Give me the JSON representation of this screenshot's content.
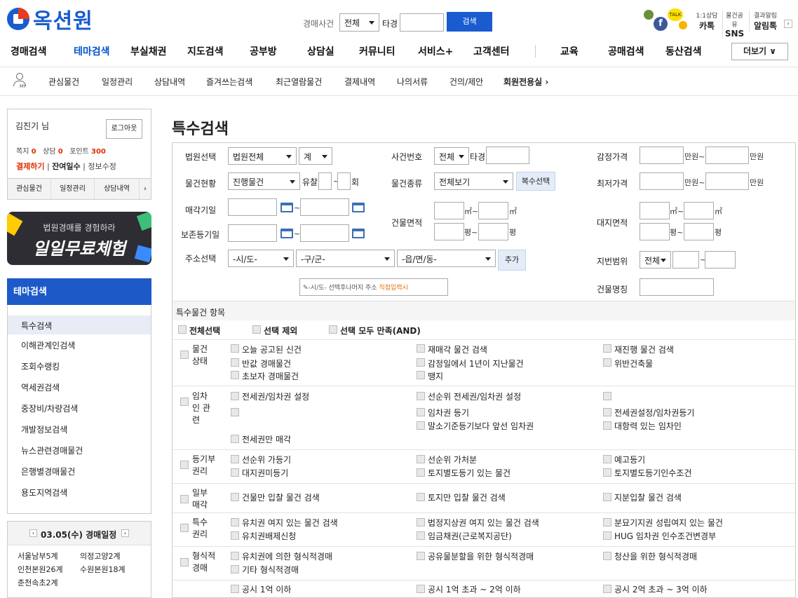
{
  "header": {
    "logo_text": "옥션원",
    "search_label": "경매사건",
    "search_select": "전체",
    "search_mid": "타경",
    "search_button": "검색",
    "consult_label": "1:1상담",
    "consult_value": "카톡",
    "share_label": "물건공유",
    "share_value": "SNS",
    "alert_label": "결과알림",
    "alert_value": "알림톡"
  },
  "nav": {
    "items": [
      "경매검색",
      "테마검색",
      "부실채권",
      "지도검색",
      "공부방",
      "상담실",
      "커뮤니티",
      "서비스+",
      "고객센터",
      "교육",
      "공매검색",
      "동산검색"
    ],
    "more": "더보기 ∨",
    "active_color": "#0055cc"
  },
  "subnav": {
    "my_label": "MY",
    "items": [
      "관심물건",
      "일정관리",
      "상담내역",
      "즐겨쓰는검색",
      "최근열람물건",
      "결제내역",
      "나의서류",
      "건의/제안",
      "회원전용실"
    ]
  },
  "user": {
    "name": "김진기",
    "suffix": "님",
    "logout": "로그아웃",
    "note_label": "쪽지",
    "note_value": "0",
    "consult_label": "상담",
    "consult_value": "0",
    "point_label": "포인트",
    "point_value": "300",
    "pay": "결제하기",
    "remain": "잔여일수",
    "info": "정보수정",
    "tabs": [
      "관심물건",
      "일정관리",
      "상담내역"
    ]
  },
  "banner": {
    "line1": "법원경매를 경험하라",
    "line2": "일일무료체험"
  },
  "sidebar": {
    "title": "테마검색",
    "items": [
      "특수검색",
      "이해관계인검색",
      "조회수랭킹",
      "역세권검색",
      "중장비/차량검색",
      "개발정보검색",
      "뉴스관련경매물건",
      "은행별경매물건",
      "용도지역검색"
    ]
  },
  "schedule": {
    "title": "03.05(수) 경매일정",
    "rows": [
      [
        "서울남부5계",
        "의정고양2계"
      ],
      [
        "인천본원26계",
        "수원본원18계"
      ],
      [
        "춘천속초2계",
        ""
      ]
    ]
  },
  "main": {
    "title": "특수검색",
    "court_label": "법원선택",
    "court_select": "법원전체",
    "court_select2": "계",
    "case_label": "사건번호",
    "case_select": "전체",
    "case_mid": "타경",
    "appraisal_label": "감정가격",
    "unit_man": "만원",
    "unit_tilde": "~",
    "status_label": "물건현황",
    "status_select": "진행물건",
    "yuchal": "유찰",
    "hoe": "회",
    "type_label": "물건종류",
    "type_select": "전체보기",
    "multi_button": "복수선택",
    "min_label": "최저가격",
    "sale_label": "매각기일",
    "preserve_label": "보존등기일",
    "building_area_label": "건물면적",
    "land_area_label": "대지면적",
    "sqm": "㎡",
    "pyeong": "평",
    "addr_label": "주소선택",
    "sido": "-시/도-",
    "gugun": "-구/군-",
    "dong": "-읍/면/동-",
    "add_button": "추가",
    "lot_label": "지번범위",
    "lot_select": "전체",
    "hint_text": "-시/도- 선택후나머지 주소",
    "hint_link": "직접입력시",
    "bldg_name_label": "건물명칭",
    "special_heading": "특수물건 항목",
    "opt_all": "전체선택",
    "opt_exclude": "선택 제외",
    "opt_and": "선택 모두 만족(AND)"
  },
  "groups": [
    {
      "name": "물건 상태",
      "items": [
        [
          "오늘 공고된 신건",
          "재매각 물건 검색",
          "재진행 물건 검색"
        ],
        [
          "반값 경매물건",
          "감정일에서 1년이 지난물건",
          "위반건축물"
        ],
        [
          "초보자 경매물건",
          "땡지",
          ""
        ]
      ]
    },
    {
      "name": "임차인 관련",
      "items": [
        [
          "전세권/임차권 설정",
          "선순위 전세권/임차권 설정",
          ""
        ],
        [
          "",
          "임차권 등기",
          "전세권설정/임차권등기"
        ],
        [
          "",
          "말소기준등기보다 앞선 임차권",
          "대항력 있는 임차인"
        ],
        [
          "전세권만 매각",
          "",
          ""
        ]
      ]
    },
    {
      "name": "등기부 권리",
      "items": [
        [
          "선순위 가등기",
          "선순위 가처분",
          "예고등기"
        ],
        [
          "대지권미등기",
          "토지별도등기 있는 물건",
          "토지별도등기인수조건"
        ]
      ]
    },
    {
      "name": "일부 매각",
      "items": [
        [
          "건물만 입찰 물건 검색",
          "토지만 입찰 물건 검색",
          "지분입찰 물건 검색"
        ]
      ]
    },
    {
      "name": "특수 권리",
      "items": [
        [
          "유치권 여지 있는 물건 검색",
          "법정지상권 여지 있는 물건 검색",
          "분묘기지권 성립여지 있는 물건"
        ],
        [
          "유치권배제신청",
          "임금채권(근로복지공단)",
          "HUG 임차권 인수조건변경부"
        ]
      ]
    },
    {
      "name": "형식적 경매",
      "items": [
        [
          "유치권에 의한 형식적경매",
          "공유물분할을 위한 형식적경매",
          "청산을 위한 형식적경매"
        ],
        [
          "기타 형식적경매",
          "",
          ""
        ]
      ]
    },
    {
      "name": "",
      "items": [
        [
          "공시 1억 이하",
          "공시 1억 초과 ~ 2억 이하",
          "공시 2억 초과 ~ 3억 이하"
        ]
      ]
    }
  ]
}
